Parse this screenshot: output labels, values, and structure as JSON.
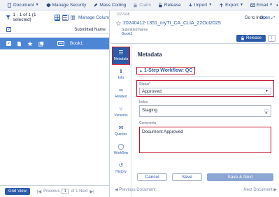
{
  "toolbar": {
    "items": [
      {
        "label": "Document",
        "icon": "document-icon",
        "caret": true
      },
      {
        "label": "Manage Security",
        "icon": "security-icon",
        "caret": false
      },
      {
        "label": "Mass Coding",
        "icon": "pencil-icon",
        "caret": false
      },
      {
        "label": "Claim",
        "icon": "lock-icon",
        "caret": false,
        "disabled": true
      },
      {
        "label": "Release",
        "icon": "release-icon",
        "caret": false
      },
      {
        "label": "Import",
        "icon": "import-icon",
        "caret": true
      },
      {
        "label": "Export",
        "icon": "export-icon",
        "caret": true
      },
      {
        "label": "Email",
        "icon": "email-icon",
        "caret": true
      }
    ],
    "more": "•••"
  },
  "left": {
    "count": "1 - 1 of 1 (1 selected)",
    "manage_columns": "Manage Colum",
    "column_header": "Submitted Name",
    "row": {
      "name": "Book1",
      "dots": "•••"
    },
    "grid_view": "Grid View",
    "previous": "Previous",
    "page": "1",
    "of_next": "of 1 Next"
  },
  "right": {
    "doc_id": "1227438",
    "go_to_index": "Go to Index",
    "open": "Open",
    "title": "20240412-1351_myTI_CA_CLIA_22Oct2025",
    "submitted_label": "Submitted Name",
    "submitted_value": "Book1",
    "release": "Release",
    "rail": [
      {
        "label": "Metadata",
        "icon": "list-icon",
        "active": true
      },
      {
        "label": "Info",
        "icon": "info-icon"
      },
      {
        "label": "Related",
        "icon": "link-icon"
      },
      {
        "label": "Versions",
        "icon": "versions-icon"
      },
      {
        "label": "Queries",
        "icon": "chat-icon"
      },
      {
        "label": "Workflow",
        "icon": "workflow-icon"
      },
      {
        "label": "History",
        "icon": "history-icon"
      }
    ],
    "panel_title": "Metadata",
    "workflow": "1-Step Workflow: QC",
    "status_label": "Status*",
    "status_value": "Approved",
    "index_label": "Index",
    "index_value": "Staging",
    "comments_label": "Comments",
    "comments_value": "Document Approved",
    "cancel": "Cancel",
    "save": "Save",
    "save_next": "Save & Next",
    "prev_doc": "Previous Document",
    "next_doc": "Next Document"
  },
  "colors": {
    "accent": "#2c5ba8",
    "selected_row": "#4e86d6",
    "highlight": "#c4142e"
  }
}
